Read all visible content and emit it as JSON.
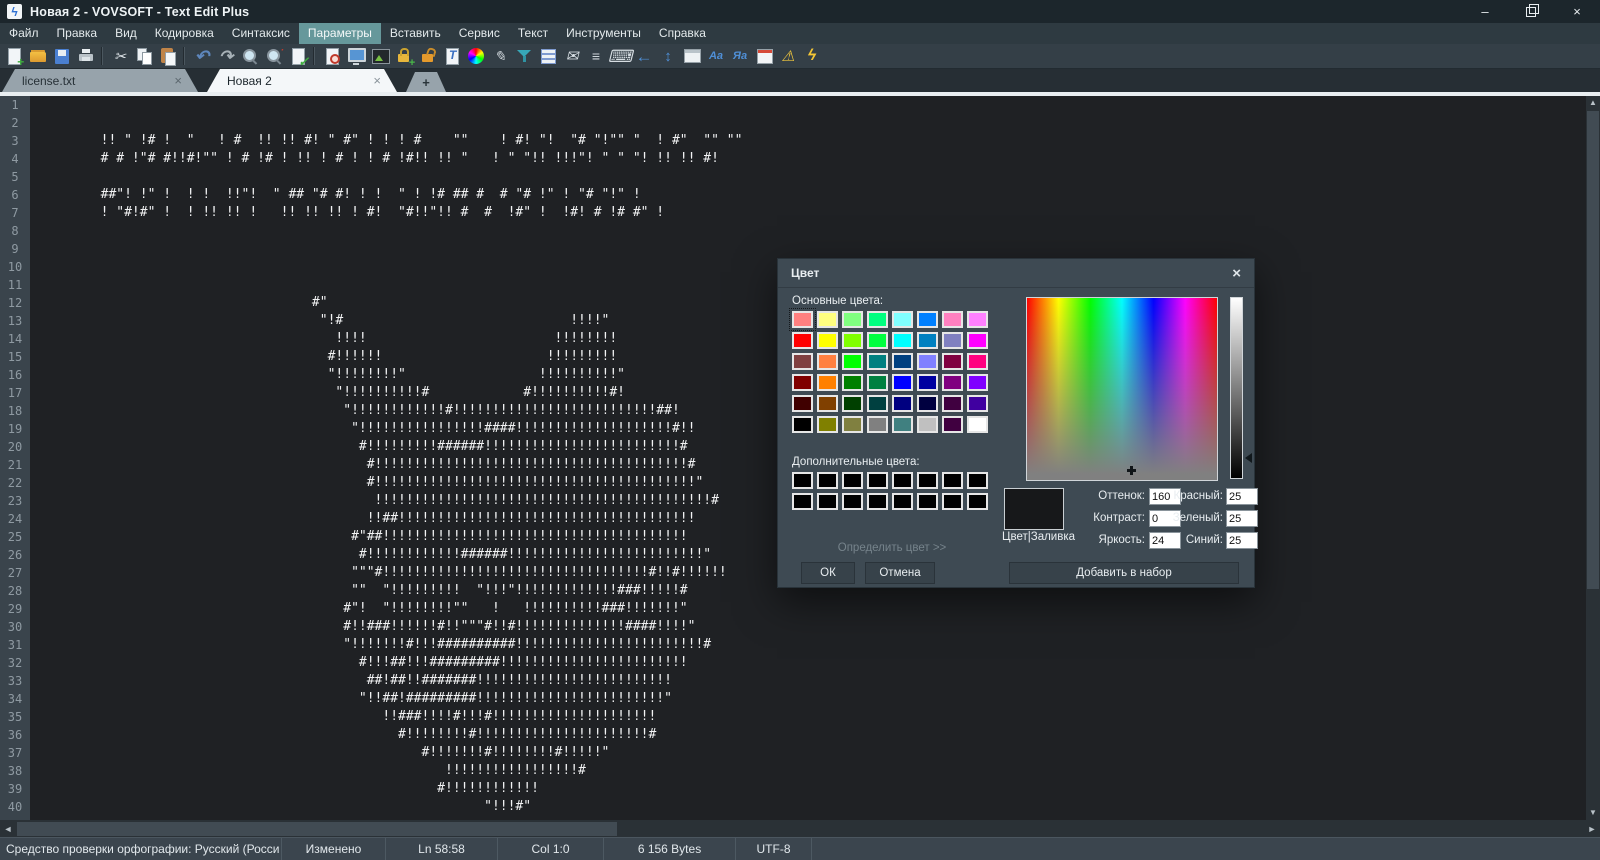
{
  "colors": {
    "titlebar_bg": "#1c262c",
    "menubar_bg": "#2e3a41",
    "menu_highlight": "#66989b",
    "editor_bg": "#1f2124",
    "gutter_bg": "#3a444c",
    "dialog_bg": "#3e4a53",
    "active_tab_bg": "#f4f7f9",
    "inactive_tab_bg": "#97a3ab",
    "selected_basic_color": "#FF8080"
  },
  "window": {
    "app_icon_glyph": "ϟ",
    "title": "Новая 2 - VOVSOFT - Text Edit Plus",
    "minimize_glyph": "–",
    "close_glyph": "×"
  },
  "menu": {
    "items": [
      {
        "label": "Файл"
      },
      {
        "label": "Правка"
      },
      {
        "label": "Вид"
      },
      {
        "label": "Кодировка"
      },
      {
        "label": "Синтаксис"
      },
      {
        "label": "Параметры",
        "cls": "active"
      },
      {
        "label": "Вставить"
      },
      {
        "label": "Сервис"
      },
      {
        "label": "Текст"
      },
      {
        "label": "Инструменты"
      },
      {
        "label": "Справка"
      }
    ]
  },
  "toolbar": {
    "icons": [
      {
        "name": "new-file-icon",
        "cls": "ic-new",
        "cls2": "pgb",
        "glyph": "+",
        "inter": "true"
      },
      {
        "name": "open-folder-icon",
        "cls": "ic-open",
        "glyph": "",
        "inter": "true"
      },
      {
        "name": "save-icon",
        "cls": "ic-save",
        "glyph": "",
        "inter": "true"
      },
      {
        "name": "print-icon",
        "cls": "ic-print",
        "glyph": "",
        "inter": "true"
      },
      {
        "name": "toolbar-separator",
        "cls": "ic-sep",
        "glyph": "",
        "inter": "false"
      },
      {
        "name": "cut-icon",
        "cls": "ic-cut",
        "glyph": "✂",
        "inter": "true"
      },
      {
        "name": "copy-icon",
        "cls": "ic-copy",
        "glyph": "",
        "inter": "true"
      },
      {
        "name": "paste-icon",
        "cls": "ic-paste",
        "glyph": "",
        "inter": "true"
      },
      {
        "name": "toolbar-separator",
        "cls": "ic-sep",
        "glyph": "",
        "inter": "false"
      },
      {
        "name": "undo-icon",
        "cls": "ic-undo",
        "glyph": "↶",
        "inter": "true"
      },
      {
        "name": "redo-icon",
        "cls": "ic-redo",
        "glyph": "↷",
        "inter": "true"
      },
      {
        "name": "search-icon",
        "cls": "ic-search",
        "glyph": "",
        "inter": "true"
      },
      {
        "name": "search-replace-icon",
        "cls": "ic-replace",
        "glyph": "·",
        "inter": "true"
      },
      {
        "name": "spellcheck-icon",
        "cls": "ic-spell",
        "cls2": "pgb",
        "glyph": "✓",
        "inter": "true"
      },
      {
        "name": "toolbar-separator",
        "cls": "ic-sep",
        "glyph": "",
        "inter": "false"
      },
      {
        "name": "print-preview-icon",
        "cls": "ic-preview",
        "cls2": "pgb",
        "glyph": "",
        "inter": "true"
      },
      {
        "name": "monitor-icon",
        "cls": "ic-monitor",
        "glyph": "",
        "inter": "true"
      },
      {
        "name": "image-colors-icon",
        "cls": "ic-image",
        "glyph": "",
        "inter": "true"
      },
      {
        "name": "encrypt-lock-icon",
        "cls": "ic-lock",
        "glyph": "+",
        "inter": "true"
      },
      {
        "name": "decrypt-lock-icon",
        "cls": "ic-unlock",
        "glyph": "",
        "inter": "true"
      },
      {
        "name": "font-icon",
        "cls": "ic-font",
        "cls2": "pgb",
        "glyph": "T",
        "inter": "true"
      },
      {
        "name": "color-wheel-icon",
        "cls": "ic-wheel",
        "glyph": "",
        "inter": "true"
      },
      {
        "name": "pen-icon",
        "cls": "ic-pen",
        "glyph": "✎",
        "inter": "true"
      },
      {
        "name": "filter-icon",
        "cls": "ic-filter",
        "glyph": "",
        "inter": "true"
      },
      {
        "name": "document-lines-icon",
        "cls": "ic-doc",
        "glyph": "",
        "inter": "true"
      },
      {
        "name": "mail-icon",
        "cls": "ic-mail",
        "glyph": "✉",
        "inter": "true"
      },
      {
        "name": "numbered-list-icon",
        "cls": "ic-numlist",
        "glyph": "≡",
        "inter": "true"
      },
      {
        "name": "keyboard-icon",
        "cls": "ic-keyboard",
        "glyph": "⌨",
        "inter": "true"
      },
      {
        "name": "back-arrow-icon",
        "cls": "ic-back",
        "glyph": "←",
        "inter": "true"
      },
      {
        "name": "up-down-arrows-icon",
        "cls": "ic-updown",
        "glyph": "↕",
        "inter": "true"
      },
      {
        "name": "script-window-icon",
        "cls": "ic-window",
        "glyph": "",
        "inter": "true"
      },
      {
        "name": "sort-az-icon",
        "cls": "ic-sortaz",
        "glyph": "Aa",
        "inter": "true"
      },
      {
        "name": "translate-icon",
        "cls": "ic-translate",
        "glyph": "Яa",
        "inter": "true"
      },
      {
        "name": "calendar-icon",
        "cls": "ic-calendar",
        "glyph": "",
        "inter": "true"
      },
      {
        "name": "warning-icon",
        "cls": "ic-warning",
        "glyph": "⚠",
        "inter": "true"
      },
      {
        "name": "flash-icon",
        "cls": "ic-flash",
        "glyph": "ϟ",
        "inter": "true"
      }
    ]
  },
  "tabs": {
    "tab1": {
      "label": "license.txt",
      "close_glyph": "×"
    },
    "tab2": {
      "label": "Новая 2",
      "close_glyph": "×"
    },
    "new_tab_glyph": "+"
  },
  "scrollbar": {
    "up": "▲",
    "down": "▼",
    "left": "◄",
    "right": "►"
  },
  "editor": {
    "lines": [
      {
        "n": "1",
        "t": ""
      },
      {
        "n": "2",
        "t": ""
      },
      {
        "n": "3",
        "t": "        !! \" !# !  \"   ! #  !! !! #! \" #\" ! ! ! #    \"\"    ! #! \"!  \"# \"!\"\" \"  ! #\"  \"\" \"\""
      },
      {
        "n": "4",
        "t": "        # # !\"# #!!#!\"\" ! # !# ! !! ! # ! ! # !#!! !! \"   ! \" \"!! !!!\"! \" \" \"! !! !! #!"
      },
      {
        "n": "5",
        "t": ""
      },
      {
        "n": "6",
        "t": "        ##\"! !\" !  ! !  !!\"!  \" ## \"# #! ! !  \" ! !# ## #  # \"# !\" ! \"# \"!\" !"
      },
      {
        "n": "7",
        "t": "        ! \"#!#\" !  ! !! !! !   !! !! !! ! #!  \"#!!\"!! #  #  !#\" !  !#! # !# #\" !"
      },
      {
        "n": "8",
        "t": ""
      },
      {
        "n": "9",
        "t": ""
      },
      {
        "n": "10",
        "t": ""
      },
      {
        "n": "11",
        "t": ""
      },
      {
        "n": "12",
        "t": "                                   #\""
      },
      {
        "n": "13",
        "t": "                                    \"!#                             !!!!\""
      },
      {
        "n": "14",
        "t": "                                      !!!!                        !!!!!!!!"
      },
      {
        "n": "15",
        "t": "                                     #!!!!!!                     !!!!!!!!!"
      },
      {
        "n": "16",
        "t": "                                     \"!!!!!!!!\"                 !!!!!!!!!!\""
      },
      {
        "n": "17",
        "t": "                                      \"!!!!!!!!!!#            #!!!!!!!!!!#!"
      },
      {
        "n": "18",
        "t": "                                       \"!!!!!!!!!!!!#!!!!!!!!!!!!!!!!!!!!!!!!!!##!"
      },
      {
        "n": "19",
        "t": "                                        \"!!!!!!!!!!!!!!!!####!!!!!!!!!!!!!!!!!!!!#!!"
      },
      {
        "n": "20",
        "t": "                                         #!!!!!!!!!######!!!!!!!!!!!!!!!!!!!!!!!!!#"
      },
      {
        "n": "21",
        "t": "                                          #!!!!!!!!!!!!!!!!!!!!!!!!!!!!!!!!!!!!!!!!#"
      },
      {
        "n": "22",
        "t": "                                          #!!!!!!!!!!!!!!!!!!!!!!!!!!!!!!!!!!!!!!!!!\""
      },
      {
        "n": "23",
        "t": "                                           !!!!!!!!!!!!!!!!!!!!!!!!!!!!!!!!!!!!!!!!!!!#"
      },
      {
        "n": "24",
        "t": "                                          !!##!!!!!!!!!!!!!!!!!!!!!!!!!!!!!!!!!!!!!!"
      },
      {
        "n": "25",
        "t": "                                        #\"##!!!!!!!!!!!!!!!!!!!!!!!!!!!!!!!!!!!!!!!"
      },
      {
        "n": "26",
        "t": "                                         #!!!!!!!!!!!!######!!!!!!!!!!!!!!!!!!!!!!!!!\""
      },
      {
        "n": "27",
        "t": "                                        \"\"\"#!!!!!!!!!!!!!!!!!!!!!!!!!!!!!!!!!!#!!#!!!!!!"
      },
      {
        "n": "28",
        "t": "                                        \"\"  \"!!!!!!!!!  \"!!!\"!!!!!!!!!!!!!###!!!!!#"
      },
      {
        "n": "29",
        "t": "                                       #\"!  \"!!!!!!!!\"\"   !   !!!!!!!!!!###!!!!!!!\""
      },
      {
        "n": "30",
        "t": "                                       #!!###!!!!!!#!!\"\"\"#!!#!!!!!!!!!!!!!!####!!!!\""
      },
      {
        "n": "31",
        "t": "                                       \"!!!!!!!#!!!##########!!!!!!!!!!!!!!!!!!!!!!!!#"
      },
      {
        "n": "32",
        "t": "                                         #!!!##!!!#########!!!!!!!!!!!!!!!!!!!!!!!!"
      },
      {
        "n": "33",
        "t": "                                          ##!##!!#######!!!!!!!!!!!!!!!!!!!!!!!!!"
      },
      {
        "n": "34",
        "t": "                                         \"!!##!#########!!!!!!!!!!!!!!!!!!!!!!!!\""
      },
      {
        "n": "35",
        "t": "                                            !!###!!!!#!!!#!!!!!!!!!!!!!!!!!!!!!"
      },
      {
        "n": "36",
        "t": "                                              #!!!!!!!!#!!!!!!!!!!!!!!!!!!!!!!#"
      },
      {
        "n": "37",
        "t": "                                                 #!!!!!!!#!!!!!!!!#!!!!!\""
      },
      {
        "n": "38",
        "t": "                                                    !!!!!!!!!!!!!!!!!#"
      },
      {
        "n": "39",
        "t": "                                                   #!!!!!!!!!!!!"
      },
      {
        "n": "40",
        "t": "                                                         \"!!!#\""
      }
    ]
  },
  "status": {
    "cells": [
      "Средство проверки орфографии: Русский (Росси",
      "Изменено",
      "Ln 58:58",
      "Col 1:0",
      "6 156 Bytes",
      "UTF-8"
    ]
  },
  "dialog": {
    "title": "Цвет",
    "close_glyph": "×",
    "basic_label": "Основные цвета:",
    "basic_colors": [
      "#FF8080",
      "#FFFF80",
      "#80FF80",
      "#00FF80",
      "#80FFFF",
      "#0080FF",
      "#FF80C0",
      "#FF80FF",
      "#FF0000",
      "#FFFF00",
      "#80FF00",
      "#00FF40",
      "#00FFFF",
      "#0080C0",
      "#8080C0",
      "#FF00FF",
      "#804040",
      "#FF8040",
      "#00FF00",
      "#008080",
      "#004080",
      "#8080FF",
      "#800040",
      "#FF0080",
      "#800000",
      "#FF8000",
      "#008000",
      "#008040",
      "#0000FF",
      "#0000A0",
      "#800080",
      "#8000FF",
      "#400000",
      "#804000",
      "#004000",
      "#004040",
      "#000080",
      "#000040",
      "#400040",
      "#4000A0",
      "#000000",
      "#808000",
      "#808040",
      "#808080",
      "#408080",
      "#C0C0C0",
      "#400040",
      "#FFFFFF"
    ],
    "custom_label": "Дополнительные цвета:",
    "custom_colors": [
      "#000000",
      "#000000",
      "#000000",
      "#000000",
      "#000000",
      "#000000",
      "#000000",
      "#000000",
      "#000000",
      "#000000",
      "#000000",
      "#000000",
      "#000000",
      "#000000",
      "#000000",
      "#000000"
    ],
    "define_link": "Определить цвет >>",
    "preview_label": "Цвет|Заливка",
    "fields": {
      "hue": {
        "label": "Оттенок:",
        "value": "160"
      },
      "sat": {
        "label": "Контраст:",
        "value": "0"
      },
      "lum": {
        "label": "Яркость:",
        "value": "24"
      },
      "red": {
        "label": "Красный:",
        "value": "25"
      },
      "green": {
        "label": "Зеленый:",
        "value": "25"
      },
      "blue": {
        "label": "Синий:",
        "value": "25"
      }
    },
    "buttons": {
      "ok": "ОК",
      "cancel": "Отмена",
      "add": "Добавить в набор"
    }
  }
}
